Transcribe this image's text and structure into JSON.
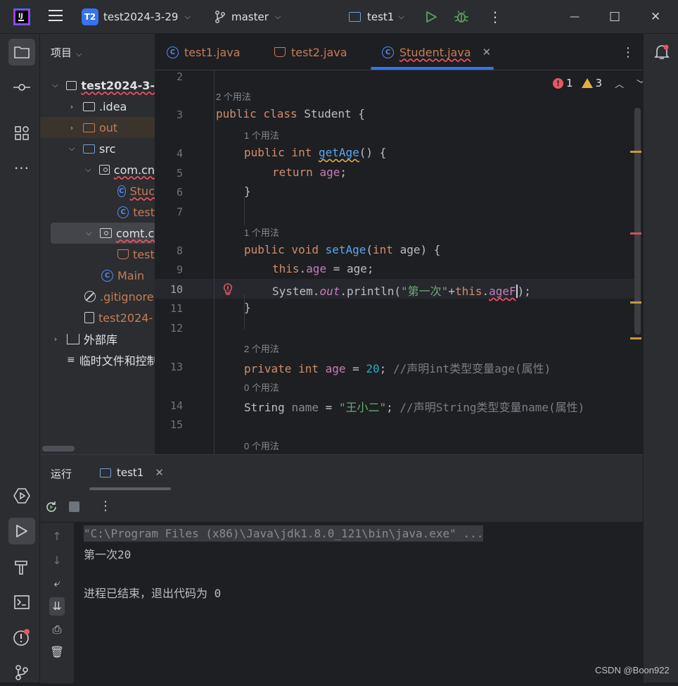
{
  "titlebar": {
    "project_badge": "T2",
    "project_name": "test2024-3-29",
    "branch": "master",
    "run_config": "test1",
    "more": "⋮",
    "minimize": "—",
    "maximize": "☐",
    "close": "✕"
  },
  "project_panel": {
    "title": "项目",
    "items": [
      {
        "label": "test2024-3-",
        "level": 0
      },
      {
        "label": ".idea",
        "level": 1
      },
      {
        "label": "out",
        "level": 1
      },
      {
        "label": "src",
        "level": 1
      },
      {
        "label": "com.cn",
        "level": 2
      },
      {
        "label": "Stuc",
        "level": 3
      },
      {
        "label": "test",
        "level": 3
      },
      {
        "label": "comt.cr",
        "level": 2
      },
      {
        "label": "test",
        "level": 3
      },
      {
        "label": "Main",
        "level": 2
      },
      {
        "label": ".gitignore",
        "level": 1
      },
      {
        "label": "test2024-",
        "level": 1
      },
      {
        "label": "外部库",
        "level": 0
      },
      {
        "label": "临时文件和控制",
        "level": 0
      }
    ]
  },
  "editor": {
    "tabs": [
      {
        "label": "test1.java",
        "active": false
      },
      {
        "label": "test2.java",
        "active": false
      },
      {
        "label": "Student.java",
        "active": true
      }
    ],
    "inspections": {
      "errors": "1",
      "warnings": "3"
    },
    "line_numbers": [
      "2",
      "3",
      "4",
      "5",
      "6",
      "7",
      "8",
      "9",
      "10",
      "11",
      "12",
      "13",
      "14",
      "15"
    ],
    "usages": {
      "class": "2 个用法",
      "getAge": "1 个用法",
      "setAge": "1 个用法",
      "age": "2 个用法",
      "name": "0 个用法",
      "next": "0 个用法"
    },
    "code": {
      "l3_kw": "public class ",
      "l3_name": "Student {",
      "l4_kw": "public int ",
      "l4_fn": "getAge",
      "l4_rest": "() {",
      "l5_kw": "return ",
      "l5_fd": "age",
      "l5_rest": ";",
      "l6": "}",
      "l8_kw": "public void ",
      "l8_fn": "setAge",
      "l8_p1": "(",
      "l8_kw2": "int",
      "l8_rest": " age) {",
      "l9_kw": "this",
      "l9_dot": ".",
      "l9_fd": "age",
      "l9_rest": " = age;",
      "l10_a": "System.",
      "l10_out": "out",
      "l10_b": ".println(",
      "l10_str": "\"第一次\"",
      "l10_c": "+",
      "l10_kw": "this",
      "l10_d": ".",
      "l10_fd": "ageF",
      "l10_e": ");",
      "l11": "}",
      "l13_kw": "private int ",
      "l13_fd": "age",
      "l13_eq": " = ",
      "l13_num": "20",
      "l13_semi": "; ",
      "l13_cm": "//声明int类型变量age(属性)",
      "l14_type": "String ",
      "l14_name": "name",
      "l14_eq": " = ",
      "l14_str": "\"王小二\"",
      "l14_semi": "; ",
      "l14_cm": "//声明String类型变量name(属性)"
    }
  },
  "run_panel": {
    "title": "运行",
    "tab": "test1",
    "console": {
      "command": "\"C:\\Program Files (x86)\\Java\\jdk1.8.0_121\\bin\\java.exe\" ...",
      "output": "第一次20",
      "exit": "进程已结束，退出代码为 0"
    }
  },
  "watermark": "CSDN @Boon922",
  "colors": {
    "accent": "#3574f0",
    "error": "#e55765",
    "warning": "#e0b040",
    "keyword": "#cf8e6d",
    "string": "#6aab73"
  }
}
